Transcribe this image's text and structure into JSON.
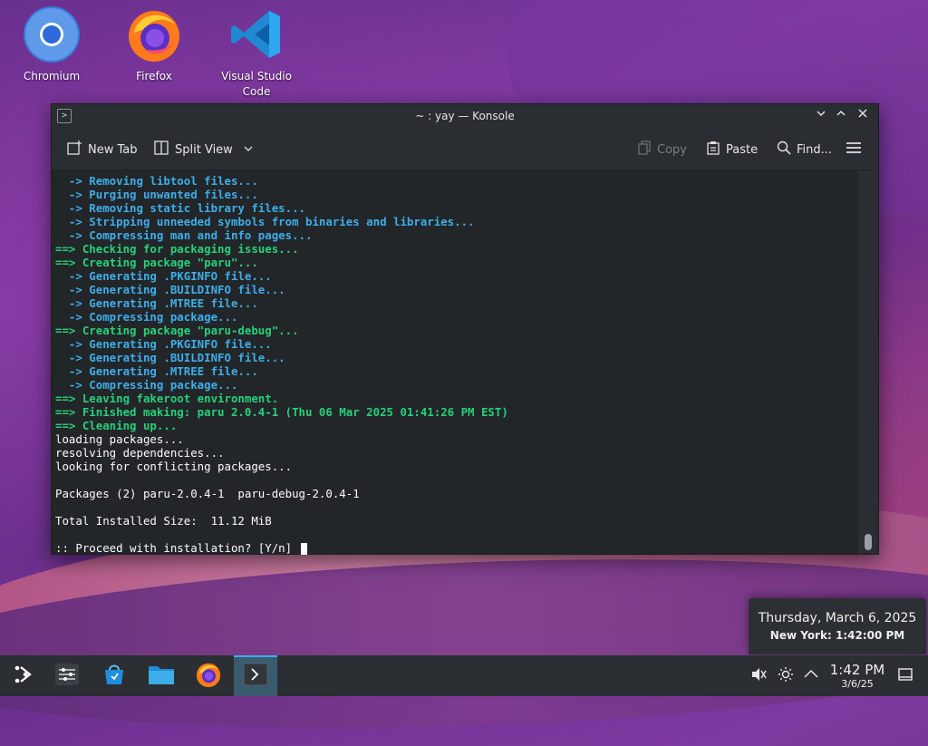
{
  "desktop": {
    "icons": [
      {
        "label": "Chromium",
        "icon": "chromium-icon"
      },
      {
        "label": "Firefox",
        "icon": "firefox-icon"
      },
      {
        "label": "Visual Studio Code",
        "icon": "vscode-icon"
      }
    ]
  },
  "window": {
    "title": "~ : yay — Konsole",
    "toolbar": {
      "new_tab": "New Tab",
      "split_view": "Split View",
      "copy": "Copy",
      "paste": "Paste",
      "find": "Find..."
    }
  },
  "terminal": {
    "lines": [
      {
        "text": "  -> Removing libtool files...",
        "color": "blue"
      },
      {
        "text": "  -> Purging unwanted files...",
        "color": "blue"
      },
      {
        "text": "  -> Removing static library files...",
        "color": "blue"
      },
      {
        "text": "  -> Stripping unneeded symbols from binaries and libraries...",
        "color": "blue"
      },
      {
        "text": "  -> Compressing man and info pages...",
        "color": "blue"
      },
      {
        "text": "==> Checking for packaging issues...",
        "color": "green"
      },
      {
        "text": "==> Creating package \"paru\"...",
        "color": "green"
      },
      {
        "text": "  -> Generating .PKGINFO file...",
        "color": "blue"
      },
      {
        "text": "  -> Generating .BUILDINFO file...",
        "color": "blue"
      },
      {
        "text": "  -> Generating .MTREE file...",
        "color": "blue"
      },
      {
        "text": "  -> Compressing package...",
        "color": "blue"
      },
      {
        "text": "==> Creating package \"paru-debug\"...",
        "color": "green"
      },
      {
        "text": "  -> Generating .PKGINFO file...",
        "color": "blue"
      },
      {
        "text": "  -> Generating .BUILDINFO file...",
        "color": "blue"
      },
      {
        "text": "  -> Generating .MTREE file...",
        "color": "blue"
      },
      {
        "text": "  -> Compressing package...",
        "color": "blue"
      },
      {
        "text": "==> Leaving fakeroot environment.",
        "color": "green"
      },
      {
        "text": "==> Finished making: paru 2.0.4-1 (Thu 06 Mar 2025 01:41:26 PM EST)",
        "color": "green"
      },
      {
        "text": "==> Cleaning up...",
        "color": "green"
      },
      {
        "text": "loading packages...",
        "color": "white"
      },
      {
        "text": "resolving dependencies...",
        "color": "white"
      },
      {
        "text": "looking for conflicting packages...",
        "color": "white"
      },
      {
        "text": "",
        "color": "white"
      },
      {
        "text": "Packages (2) paru-2.0.4-1  paru-debug-2.0.4-1",
        "color": "white"
      },
      {
        "text": "",
        "color": "white"
      },
      {
        "text": "Total Installed Size:  11.12 MiB",
        "color": "white"
      },
      {
        "text": "",
        "color": "white"
      },
      {
        "text": ":: Proceed with installation? [Y/n] ",
        "color": "white",
        "cursor": true
      }
    ]
  },
  "clock_tooltip": {
    "date_long": "Thursday, March 6, 2025",
    "city_label": "New York:",
    "city_time": "1:42:00 PM"
  },
  "taskbar": {
    "items": [
      "app-launcher-icon",
      "system-settings-icon",
      "discover-store-icon",
      "dolphin-files-icon",
      "firefox-icon",
      "konsole-icon"
    ],
    "clock_time": "1:42 PM",
    "clock_date": "3/6/25"
  },
  "colors": {
    "accent": "#3daee9",
    "term_bg": "#232629",
    "blue_text": "#3daee9",
    "green_text": "#27d07a"
  }
}
